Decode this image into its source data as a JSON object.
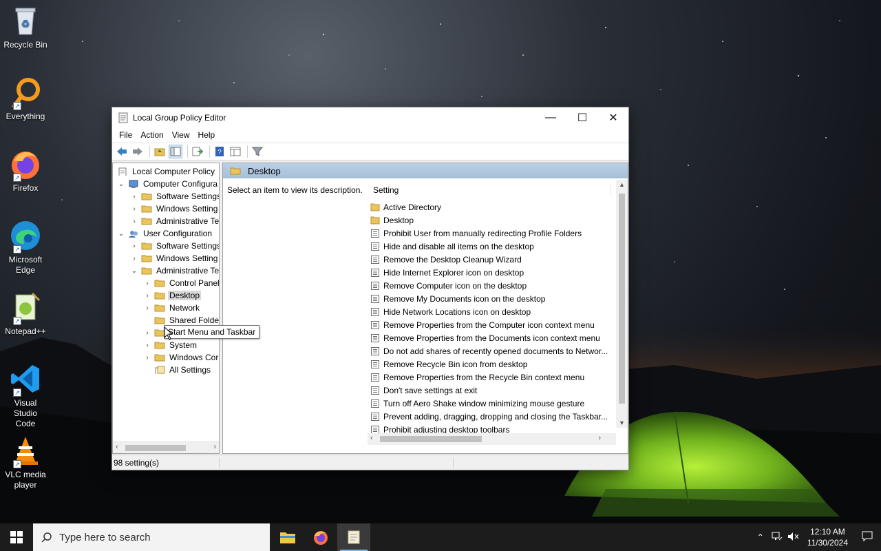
{
  "desktop": {
    "icons": [
      {
        "label": "Recycle Bin"
      },
      {
        "label": "Everything"
      },
      {
        "label": "Firefox"
      },
      {
        "label": "Microsoft Edge"
      },
      {
        "label": "Notepad++"
      },
      {
        "label": "Visual Studio Code"
      },
      {
        "label": "VLC media player"
      }
    ]
  },
  "window": {
    "title": "Local Group Policy Editor",
    "controls": {
      "minimize": "—",
      "maximize": "☐",
      "close": "✕"
    },
    "menu": [
      "File",
      "Action",
      "View",
      "Help"
    ],
    "tree": {
      "items": [
        {
          "label": "Local Computer Policy"
        },
        {
          "label": "Computer Configura"
        },
        {
          "label": "Software Settings"
        },
        {
          "label": "Windows Setting"
        },
        {
          "label": "Administrative Te"
        },
        {
          "label": "User Configuration"
        },
        {
          "label": "Software Settings"
        },
        {
          "label": "Windows Setting"
        },
        {
          "label": "Administrative Te"
        },
        {
          "label": "Control Panel"
        },
        {
          "label": "Desktop"
        },
        {
          "label": "Network"
        },
        {
          "label": "Shared Folder"
        },
        {
          "label": "Start Menu and Taskbar"
        },
        {
          "label": "System"
        },
        {
          "label": "Windows Cor"
        },
        {
          "label": "All Settings"
        }
      ]
    },
    "right": {
      "header": "Desktop",
      "description": "Select an item to view its description.",
      "column": "Setting",
      "rows": [
        "Active Directory",
        "Desktop",
        "Prohibit User from manually redirecting Profile Folders",
        "Hide and disable all items on the desktop",
        "Remove the Desktop Cleanup Wizard",
        "Hide Internet Explorer icon on desktop",
        "Remove Computer icon on the desktop",
        "Remove My Documents icon on the desktop",
        "Hide Network Locations icon on desktop",
        "Remove Properties from the Computer icon context menu",
        "Remove Properties from the Documents icon context menu",
        "Do not add shares of recently opened documents to Networ...",
        "Remove Recycle Bin icon from desktop",
        "Remove Properties from the Recycle Bin context menu",
        "Don't save settings at exit",
        "Turn off Aero Shake window minimizing mouse gesture",
        "Prevent adding, dragging, dropping and closing the Taskbar...",
        "Prohibit adjusting desktop toolbars"
      ]
    },
    "status": "98 setting(s)",
    "tooltip": "Start Menu and Taskbar"
  },
  "taskbar": {
    "search_placeholder": "Type here to search",
    "time": "12:10 AM",
    "date": "11/30/2024"
  },
  "colors": {
    "taskbar_bg": "#1c1c1c",
    "header_blue": "#a6bfd9",
    "accent": "#76b9ed"
  }
}
